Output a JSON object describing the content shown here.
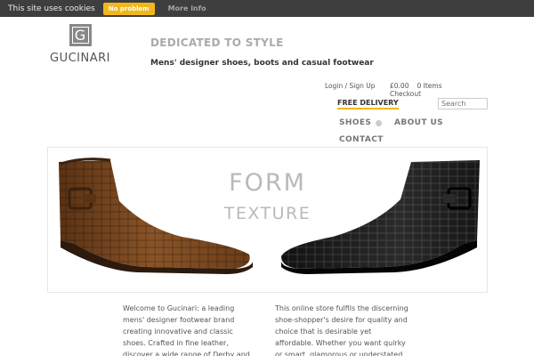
{
  "cookie_bar": {
    "text": "This site uses cookies",
    "accept_label": "No problem",
    "more_label": "More info"
  },
  "logo": {
    "letter": "G",
    "name": "GUCINARI"
  },
  "header": {
    "tagline": "DEDICATED TO STYLE",
    "subtitle": "Mens' designer shoes, boots and casual footwear"
  },
  "account": {
    "login_label": "Login / Sign Up",
    "cart_total": "£0.00",
    "cart_items": "0 Items",
    "checkout_label": "Checkout"
  },
  "promo": {
    "free_delivery": "FREE DELIVERY"
  },
  "search": {
    "placeholder": "Search"
  },
  "nav": {
    "shoes": "SHOES",
    "about": "ABOUT US",
    "contact": "CONTACT"
  },
  "banner": {
    "line1": "FORM",
    "line2": "TEXTURE"
  },
  "intro": {
    "left": "Welcome to Gucinari: a leading mens' designer footwear brand creating innovative and classic shoes. Crafted in fine leather, discover a wide range of Derby and Oxford brogues;",
    "right": "This online store fulfils the discerning shoe-shopper's desire for quality and choice that is desirable yet affordable. Whether you want quirky or smart, glamorous or understated, Gucinari is"
  },
  "colors": {
    "accent": "#f2b71b",
    "cookie_bg": "#3e3e3e",
    "brown_boot": "#7a4a22",
    "black_boot": "#1c1c1c"
  },
  "icons": {
    "logo": "g-monogram-icon",
    "shoes_toggle": "circle-chevron-icon"
  }
}
